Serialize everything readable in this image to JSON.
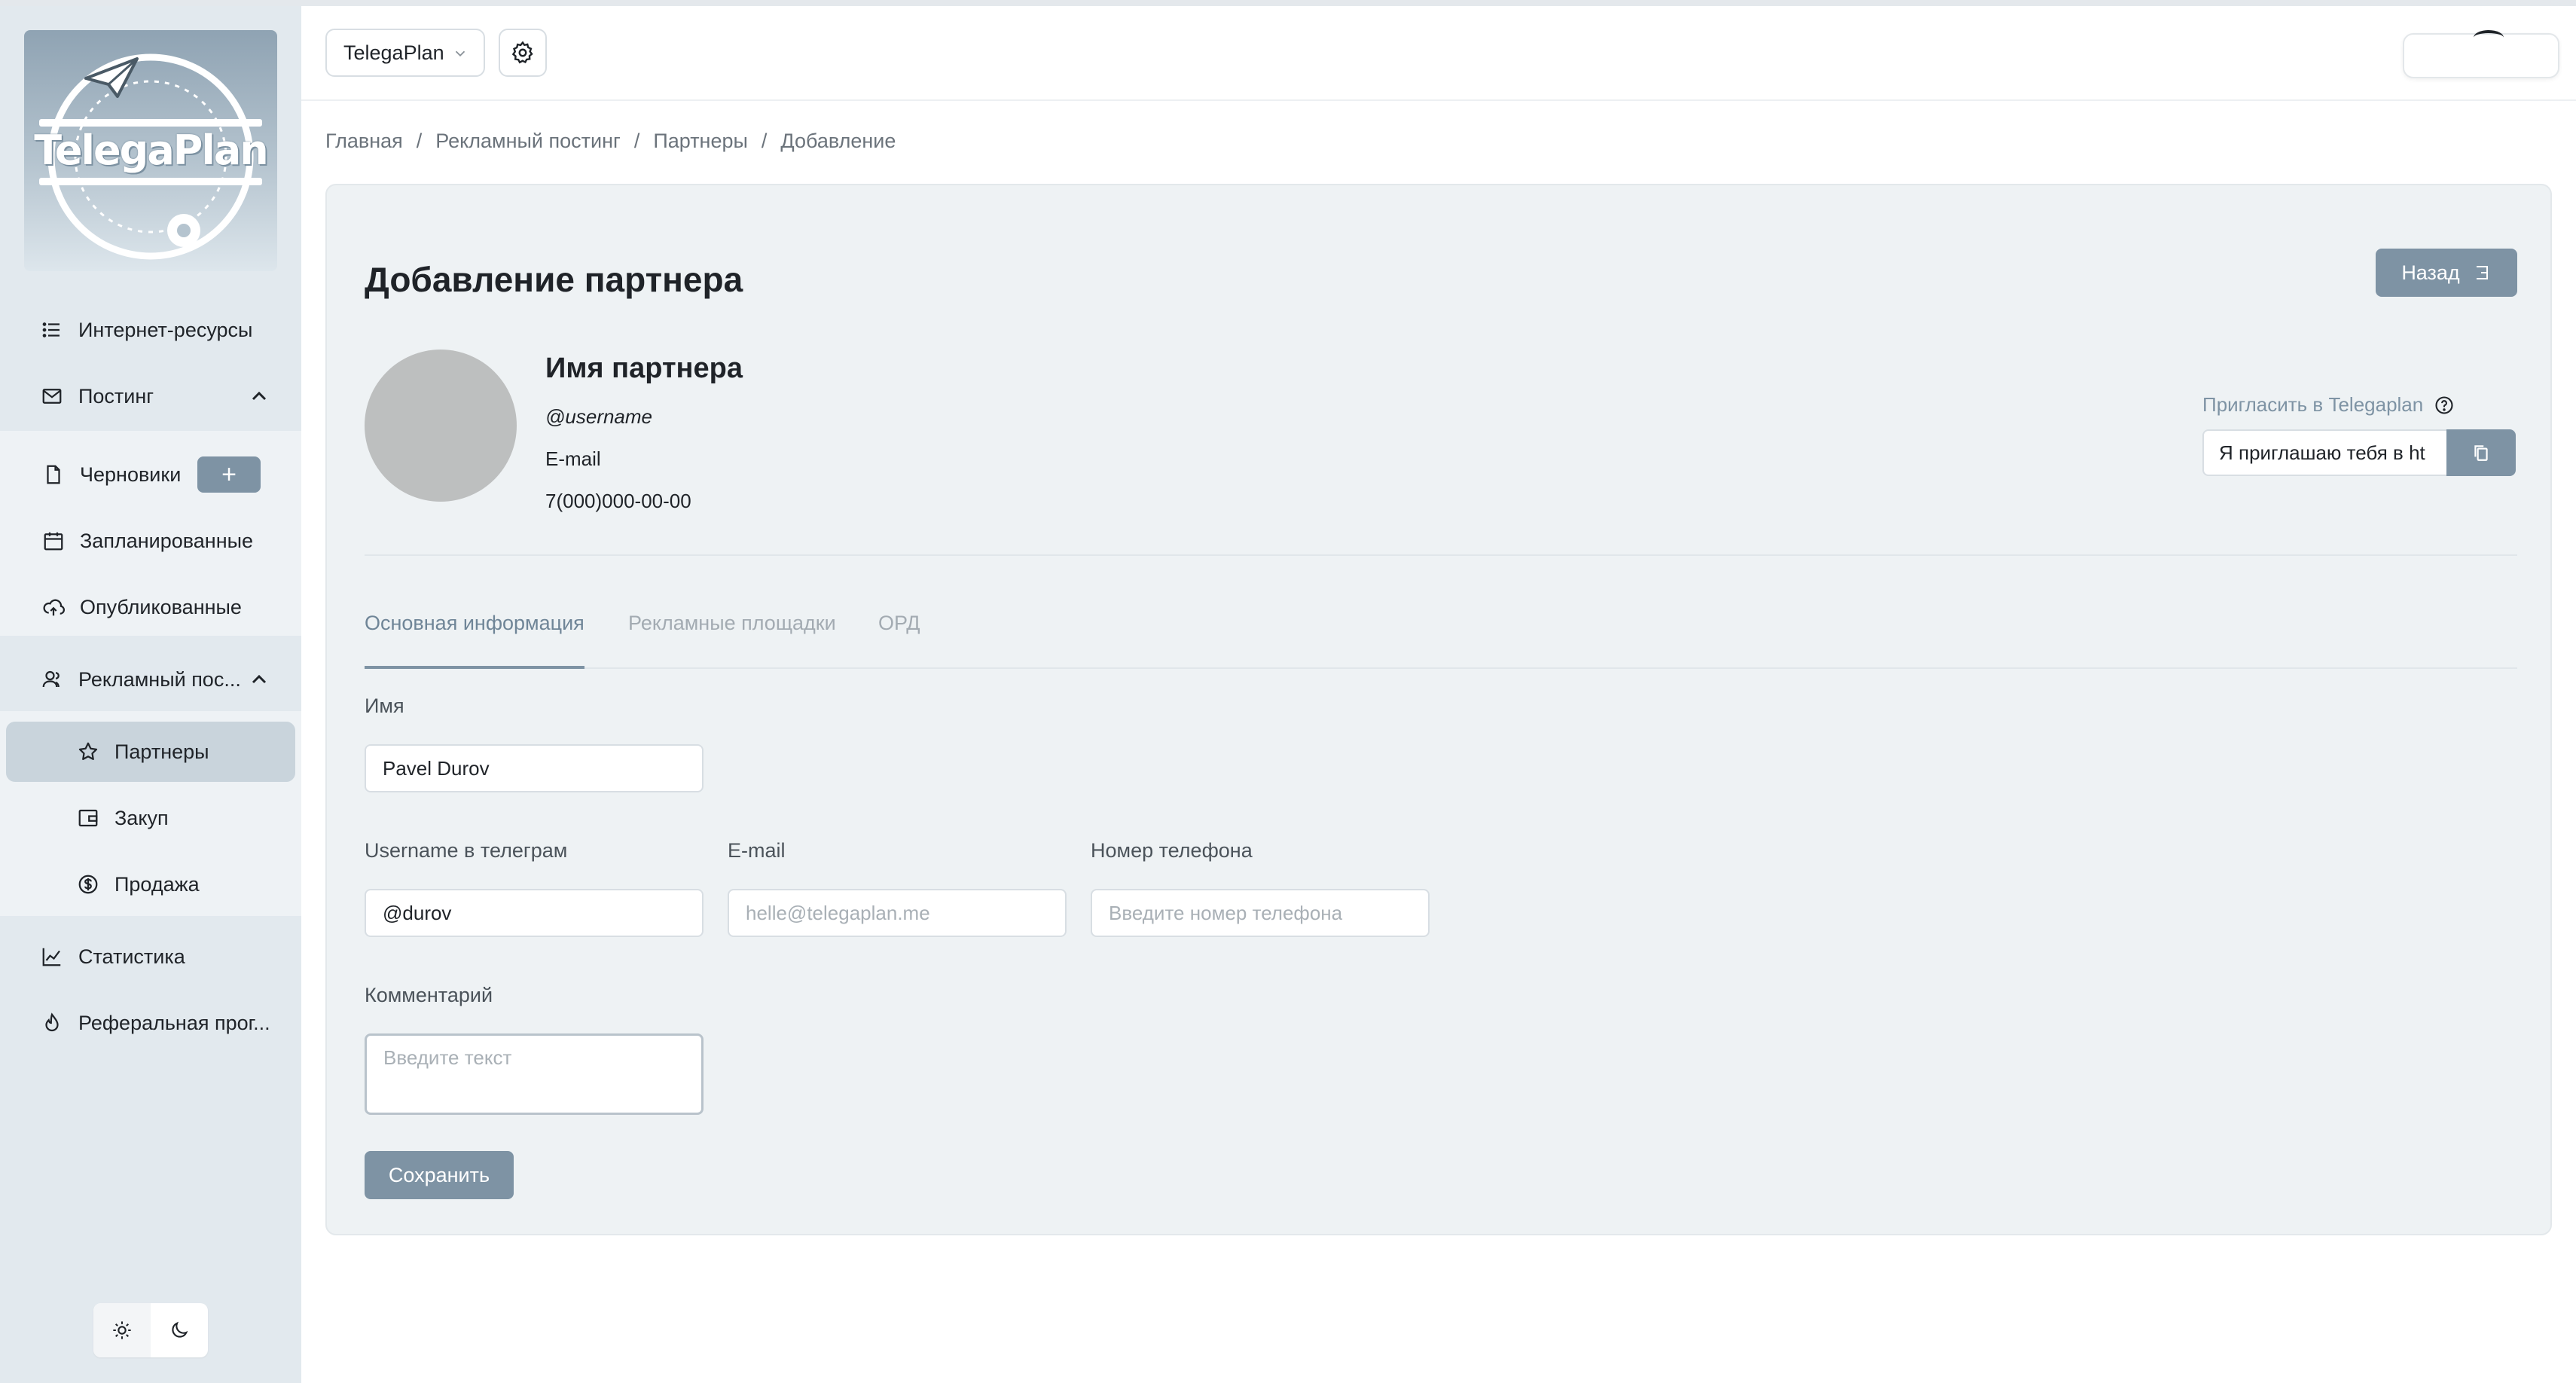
{
  "brand": {
    "logo_text": "TelegaPlan"
  },
  "header": {
    "project_name": "TelegaPlan"
  },
  "breadcrumb": [
    "Главная",
    "Рекламный постинг",
    "Партнеры",
    "Добавление"
  ],
  "sidebar": {
    "items": [
      {
        "label": "Интернет-ресурсы",
        "icon": "list-icon"
      },
      {
        "label": "Постинг",
        "icon": "mail-icon"
      },
      {
        "label": "Черновики",
        "icon": "file-icon"
      },
      {
        "label": "Запланированные",
        "icon": "calendar-icon"
      },
      {
        "label": "Опубликованные",
        "icon": "cloud-upload-icon"
      },
      {
        "label": "Рекламный пос...",
        "icon": "users-icon"
      },
      {
        "label": "Партнеры",
        "icon": "star-icon"
      },
      {
        "label": "Закуп",
        "icon": "wallet-icon"
      },
      {
        "label": "Продажа",
        "icon": "dollar-icon"
      },
      {
        "label": "Статистика",
        "icon": "chart-icon"
      },
      {
        "label": "Реферальная прог...",
        "icon": "drop-icon"
      }
    ],
    "add_draft_symbol": "+"
  },
  "card": {
    "title": "Добавление партнера",
    "back_label": "Назад",
    "partner": {
      "name": "Имя партнера",
      "username": "@username",
      "email": "E-mail",
      "phone": "7(000)000-00-00"
    },
    "invite": {
      "label": "Пригласить в Telegaplan",
      "value": "Я приглашаю тебя в ht"
    },
    "tabs": [
      "Основная информация",
      "Рекламные площадки",
      "ОРД"
    ],
    "form": {
      "name_label": "Имя",
      "name_value": "Pavel Durov",
      "username_label": "Username в телеграм",
      "username_value": "@durov",
      "email_label": "E-mail",
      "email_placeholder": "helle@telegaplan.me",
      "phone_label": "Номер телефона",
      "phone_placeholder": "Введите номер телефона",
      "comment_label": "Комментарий",
      "comment_placeholder": "Введите текст",
      "save_label": "Сохранить"
    }
  },
  "colors": {
    "accent": "#7e93a4",
    "sidebar_bg": "#e2e9ee",
    "active_bg": "#c9d4dc",
    "card_bg": "#eef2f4"
  }
}
